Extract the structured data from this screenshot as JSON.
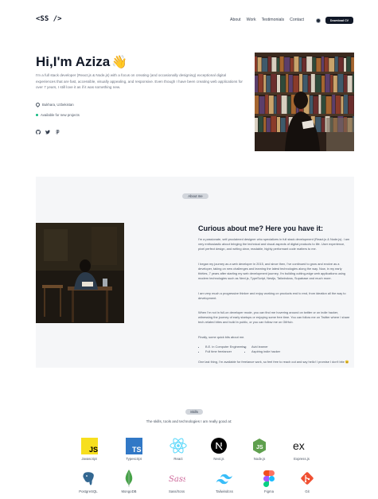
{
  "header": {
    "logo": "<SS />",
    "nav": [
      "About",
      "Work",
      "Testimonials",
      "Contact"
    ],
    "cv_button": "Download CV"
  },
  "hero": {
    "title": "Hi,I'm Aziza",
    "emoji": "👋",
    "description": "I'm a full stack developer (React.js & Node.js) with a focus on creating (and occasionally designing) exceptional digital experiences that are fast, accessible, visually appealing, and responsive. Even though I have been creating web applications for over 7 years, I still love it as if it was something new.",
    "location": "Bukhara, Uzbekistan",
    "availability": "Available for new projects",
    "social_icons": [
      "github-icon",
      "twitter-icon",
      "figma-icon"
    ]
  },
  "about": {
    "tag": "About me",
    "title": "Curious about me? Here you have it:",
    "p1": "I'm a passionate, self-proclaimed designer who specializes in full stack development (React.js & Node.js). I am very enthusiastic about bringing the technical and visual aspects of digital products to life. User experience, pixel perfect design, and writing clear, readable, highly performant code matters to me.",
    "p2": "I began my journey as a web developer in 2015, and since then, I've continued to grow and evolve as a developer, taking on new challenges and learning the latest technologies along the way. Now, in my early thirties, 7 years after starting my web development journey, I'm building cutting-edge web applications using modern technologies such as Next.js, TypeScript, Nestjs, Tailwindcss, Supabase and much more.",
    "p3": "I am very much a progressive thinker and enjoy working on products end to end, from ideation all the way to development.",
    "p4": "When I'm not in full-on developer mode, you can find me hovering around on twitter or on indie hacker, witnessing the journey of early startups or enjoying some free time. You can follow me on Twitter where I share tech-related bites and build in public, or you can follow me on GitHub.",
    "p5": "Finally, some quick bits about me.",
    "facts": [
      "B.E. in Computer Engineering",
      "Avid learner",
      "Full time freelancer",
      "Aspiring indie hacker"
    ],
    "p6": "One last thing, I'm available for freelance work, so feel free to reach out and say hello! I promise I don't bite 😉"
  },
  "skills": {
    "tag": "Skills",
    "subtitle": "The skills, tools and technologies I am really good at:",
    "items": [
      {
        "label": "Javascript",
        "icon": "javascript-icon"
      },
      {
        "label": "Typescript",
        "icon": "typescript-icon"
      },
      {
        "label": "React",
        "icon": "react-icon"
      },
      {
        "label": "Next.js",
        "icon": "nextjs-icon"
      },
      {
        "label": "Node.js",
        "icon": "nodejs-icon"
      },
      {
        "label": "Express.js",
        "icon": "expressjs-icon"
      },
      {
        "label": "PostgreSQL",
        "icon": "postgresql-icon"
      },
      {
        "label": "MongoDB",
        "icon": "mongodb-icon"
      },
      {
        "label": "Sass/Scss",
        "icon": "sass-icon"
      },
      {
        "label": "Tailwindcss",
        "icon": "tailwindcss-icon"
      },
      {
        "label": "Figma",
        "icon": "figma-icon"
      },
      {
        "label": "Git",
        "icon": "git-icon"
      }
    ]
  },
  "colors": {
    "ink": "#111827",
    "muted": "#6b7280",
    "panel": "#f5f6f8",
    "available": "#10b981",
    "js": "#f7df1e",
    "ts": "#3178c6",
    "react": "#61dafb",
    "node": "#5fa04e",
    "mongo": "#47a248",
    "sass": "#cd6799",
    "tailwind": "#38bdf8",
    "git": "#f05032"
  }
}
